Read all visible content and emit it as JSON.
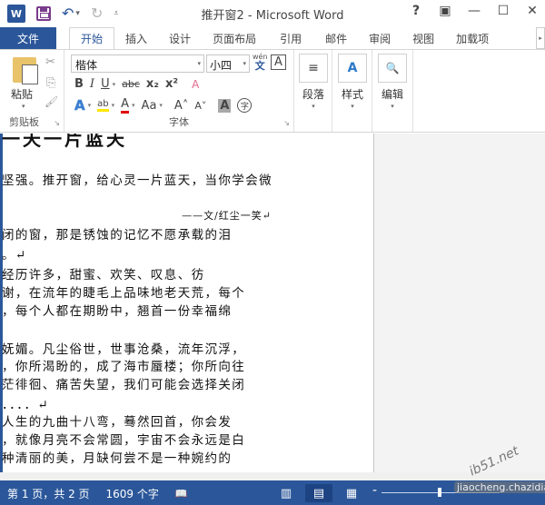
{
  "window": {
    "title": "推开窗2 - Microsoft Word",
    "app_icon": "W",
    "controls": {
      "help": "?",
      "ribbon_display": "▣",
      "minimize": "—",
      "maximize": "☐",
      "close": "✕"
    }
  },
  "quick_access": {
    "undo_icon": "↶",
    "undo_caret": "▾",
    "redo_icon": "↻",
    "customize_icon": "⩡"
  },
  "tabs": [
    {
      "label": "文件"
    },
    {
      "label": "开始"
    },
    {
      "label": "插入"
    },
    {
      "label": "设计"
    },
    {
      "label": "页面布局"
    },
    {
      "label": "引用"
    },
    {
      "label": "邮件"
    },
    {
      "label": "审阅"
    },
    {
      "label": "视图"
    },
    {
      "label": "加载项"
    }
  ],
  "tab_scroll_icon": "▸",
  "ribbon": {
    "clipboard": {
      "label": "剪贴板",
      "paste_label": "粘贴",
      "cut_icon": "✂",
      "copy_icon": "⎘",
      "format_painter_icon": "🖌",
      "launcher_icon": "↘"
    },
    "font": {
      "label": "字体",
      "font_name": "楷体",
      "font_size": "小四",
      "phonetic_guide_top": "wén",
      "phonetic_guide_bottom": "文",
      "char_border": "A",
      "bold": "B",
      "italic": "I",
      "underline": "U",
      "strikethrough": "abc",
      "subscript": "x₂",
      "superscript": "x²",
      "clear_format_icon": "A",
      "text_effects": "A",
      "highlight": "ab",
      "font_color": "A",
      "change_case": "Aa",
      "grow_font": "A˄",
      "shrink_font": "A˅",
      "char_shading": "A",
      "enclose_char": "字",
      "launcher_icon": "↘",
      "highlight_color": "#ffe600",
      "font_color_value": "#e00000"
    },
    "paragraph": {
      "label": "段落",
      "icon": "≡"
    },
    "styles": {
      "label": "样式",
      "icon": "A"
    },
    "editing": {
      "label": "编辑",
      "icon": "🔍"
    }
  },
  "document": {
    "title_fragment": "一天一片蓝天",
    "lines": [
      "坚强。推开窗，给心灵一片蓝天，当你学会微",
      "闭的窗，那是锈蚀的记忆不愿承载的泪",
      "。↵",
      "经历许多，甜蜜、欢笑、叹息、彷",
      "谢，在流年的睫毛上品味地老天荒，每个",
      "，每个人都在期盼中，翘首一份幸福绵",
      "妩媚。凡尘俗世，世事沧桑，流年沉浮，",
      "，你所渴盼的，成了海市蜃楼；你所向往",
      "茫徘徊、痛苦失望，我们可能会选择关闭",
      "．．．．↵",
      "人生的九曲十八弯，蓦然回首，你会发",
      "，就像月亮不会常圆，宇宙不会永远是白",
      "种清丽的美，月缺何尝不是一种婉约的"
    ],
    "author": "——文/红尘一笑↵"
  },
  "statusbar": {
    "page_info": "第 1 页，共 2 页",
    "word_count": "1609 个字",
    "proofing_icon": "📖",
    "view_read": "▥",
    "view_print": "▤",
    "view_web": "▦",
    "zoom_minus": "-"
  },
  "watermark": {
    "line1": "ib51.net",
    "line2": "jiaocheng.chazidian.com"
  }
}
